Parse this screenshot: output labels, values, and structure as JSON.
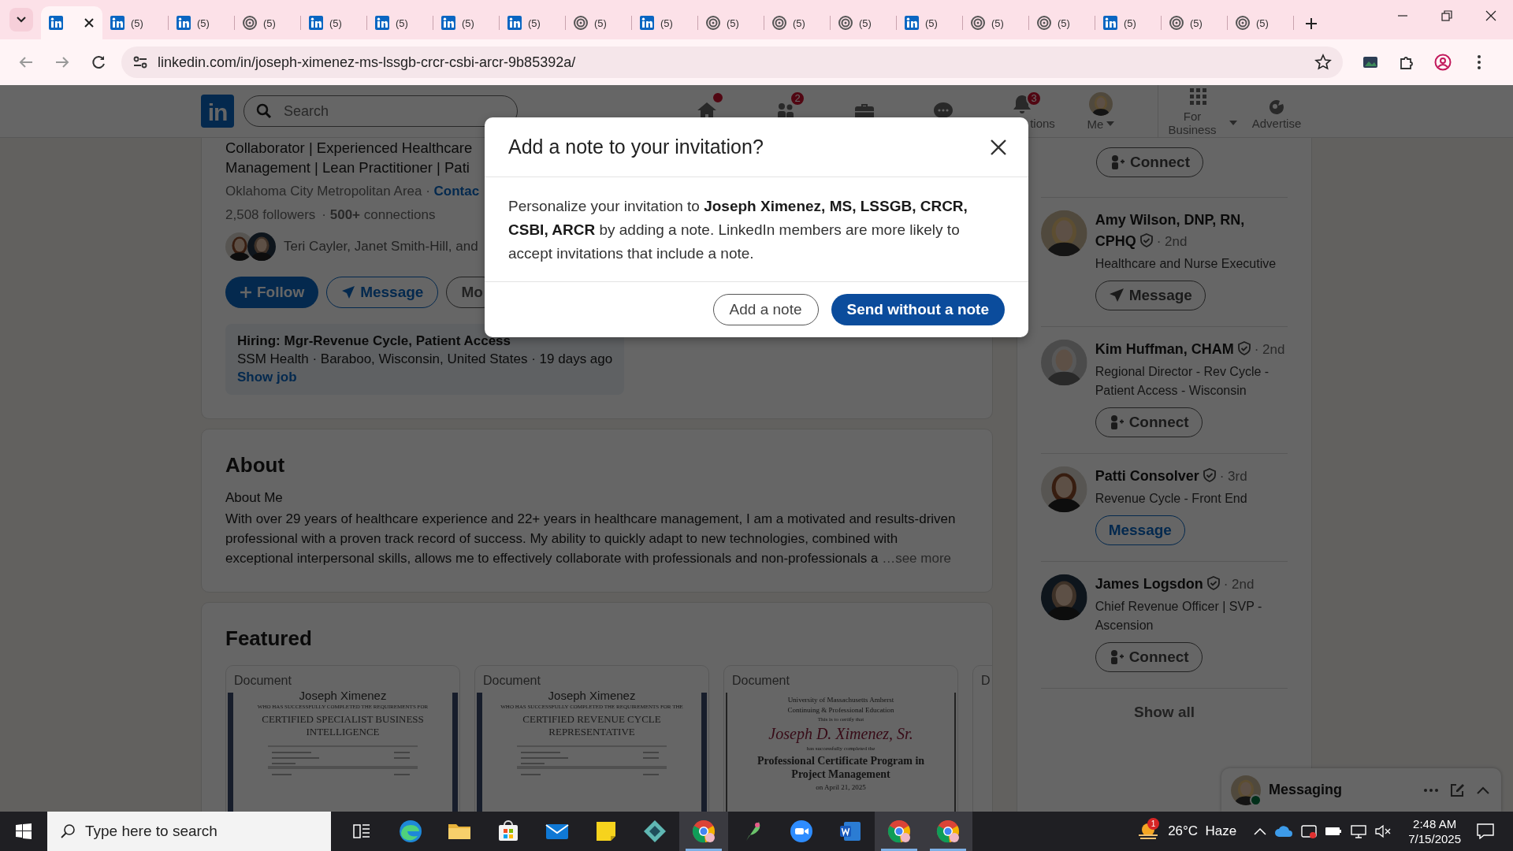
{
  "browser": {
    "tabs": [
      {
        "kind": "linkedin",
        "selected": true
      },
      {
        "kind": "linkedin",
        "title": "(5)",
        "selected": false
      },
      {
        "kind": "linkedin",
        "title": "(5)",
        "selected": false
      },
      {
        "kind": "spiral",
        "title": "(5)",
        "selected": false
      },
      {
        "kind": "linkedin",
        "title": "(5)",
        "selected": false
      },
      {
        "kind": "linkedin",
        "title": "(5)",
        "selected": false
      },
      {
        "kind": "linkedin",
        "title": "(5)",
        "selected": false
      },
      {
        "kind": "linkedin",
        "title": "(5)",
        "selected": false
      },
      {
        "kind": "spiral",
        "title": "(5)",
        "selected": false
      },
      {
        "kind": "linkedin",
        "title": "(5)",
        "selected": false
      },
      {
        "kind": "spiral",
        "title": "(5)",
        "selected": false
      },
      {
        "kind": "spiral",
        "title": "(5)",
        "selected": false
      },
      {
        "kind": "spiral",
        "title": "(5)",
        "selected": false
      },
      {
        "kind": "linkedin",
        "title": "(5)",
        "selected": false
      },
      {
        "kind": "spiral",
        "title": "(5)",
        "selected": false
      },
      {
        "kind": "spiral",
        "title": "(5)",
        "selected": false
      },
      {
        "kind": "linkedin",
        "title": "(5)",
        "selected": false
      },
      {
        "kind": "spiral",
        "title": "(5)",
        "selected": false
      },
      {
        "kind": "spiral",
        "title": "(5)",
        "selected": false
      }
    ],
    "address": "linkedin.com/in/joseph-ximenez-ms-lssgb-crcr-csbi-arcr-9b85392a/"
  },
  "header": {
    "logo": "in",
    "search": {
      "placeholder": "Search"
    },
    "nav": [
      {
        "kind": "home",
        "dot": true
      },
      {
        "kind": "network",
        "badge": "2"
      },
      {
        "kind": "jobs"
      },
      {
        "kind": "messaging"
      },
      {
        "kind": "notifications",
        "badge": "3",
        "label": "tions"
      },
      {
        "kind": "me",
        "label": "Me",
        "dropdown": true
      },
      {
        "kind": "business",
        "label": "For Business",
        "dropdown": true
      },
      {
        "kind": "advertise",
        "label": "Advertise"
      }
    ]
  },
  "profile": {
    "headline": [
      "Collaborator | Experienced Healthcare",
      "Management | Lean Practitioner | Pati"
    ],
    "location": "Oklahoma City Metropolitan Area · ",
    "contact": "Contac",
    "followers": "2,508 followers",
    "connections": "· **500+** connections",
    "mutual": "Teri Cayler, Janet Smith-Hill, and",
    "buttons": [
      {
        "kind": "primary",
        "label": "Follow"
      },
      {
        "kind": "outline",
        "label": "Message"
      },
      {
        "kind": "plain",
        "label": "Mo"
      }
    ],
    "job": {
      "title": "Hiring: Mgr-Revenue Cycle, Patient Access",
      "detail": "SSM Health · Baraboo, Wisconsin, United States · 19 days ago",
      "link": "Show job"
    }
  },
  "about": {
    "title": "About",
    "subtitle": "About Me",
    "text": "With over 29 years of healthcare experience and 22+ years in healthcare management, I am a motivated and results-driven professional with a proven track record of success. My ability to quickly adapt to new technologies, combined with exceptional interpersonal skills, allows me to effectively collaborate with professionals and non-professionals a",
    "more": "…see more"
  },
  "featured": {
    "title": "Featured",
    "items": [
      {
        "label": "Document",
        "kind": "certificate",
        "lines": [
          {
            "kind": "name",
            "text": "Joseph Ximenez"
          },
          {
            "kind": "small",
            "text": "WHO HAS SUCCESSFULLY COMPLETED THE REQUIREMENTS FOR"
          },
          {
            "kind": "title",
            "text": "CERTIFIED SPECIALIST BUSINESS INTELLIGENCE"
          }
        ]
      },
      {
        "label": "Document",
        "kind": "certificate",
        "lines": [
          {
            "kind": "name",
            "text": "Joseph Ximenez"
          },
          {
            "kind": "small",
            "text": "WHO HAS SUCCESSFULLY COMPLETED THE REQUIREMENTS FOR THE"
          },
          {
            "kind": "title",
            "text": "CERTIFIED REVENUE CYCLE REPRESENTATIVE"
          }
        ]
      },
      {
        "label": "Document",
        "kind": "diploma",
        "lines": [
          {
            "kind": "tiny",
            "text": "University of Massachusetts Amherst"
          },
          {
            "kind": "tiny",
            "text": "Continuing & Professional Education"
          },
          {
            "kind": "small",
            "text": "This is to certify that"
          },
          {
            "kind": "script",
            "text": "Joseph D. Ximenez, Sr."
          },
          {
            "kind": "small",
            "text": "has successfully completed the"
          },
          {
            "kind": "heading",
            "text": "Professional Certificate Program in Project Management"
          },
          {
            "kind": "tiny",
            "text": "on April 21, 2025"
          }
        ]
      },
      {
        "label": "D",
        "kind": "edge"
      }
    ]
  },
  "sidebar": {
    "top_action": {
      "kind": "connect",
      "label": "Connect"
    },
    "people": [
      {
        "name": "Amy Wilson, DNP, RN, CPHQ",
        "verified": true,
        "degree": "· 2nd",
        "headline": "Healthcare and Nurse Executive",
        "action": {
          "kind": "message",
          "label": "Message"
        }
      },
      {
        "name": "Kim Huffman, CHAM",
        "verified": true,
        "degree": "· 2nd",
        "headline": "Regional Director - Rev Cycle - Patient Access - Wisconsin",
        "action": {
          "kind": "connect",
          "label": "Connect"
        }
      },
      {
        "name": "Patti Consolver",
        "verified": true,
        "degree": "· 3rd",
        "headline": "Revenue Cycle - Front End",
        "action": {
          "kind": "link",
          "label": "Message"
        }
      },
      {
        "name": "James Logsdon",
        "verified": true,
        "degree": "· 2nd",
        "headline": "Chief Revenue Officer | SVP - Ascension",
        "action": {
          "kind": "connect",
          "label": "Connect"
        }
      }
    ],
    "show_all": "Show all"
  },
  "messaging": {
    "label": "Messaging",
    "online": true
  },
  "dialog": {
    "title": "Add a note to your invitation?",
    "body": "Personalize your invitation to **Joseph Ximenez, MS, LSSGB, CRCR, CSBI, ARCR** by adding a note. LinkedIn members are more likely to accept invitations that include a note.",
    "buttons": [
      {
        "kind": "secondary",
        "label": "Add a note"
      },
      {
        "kind": "primary",
        "label": "Send without a note"
      }
    ]
  },
  "taskbar": {
    "search": {
      "placeholder": "Type here to search"
    },
    "apps": [
      {
        "kind": "edge",
        "active": false
      },
      {
        "kind": "folder",
        "active": false
      },
      {
        "kind": "store",
        "active": false
      },
      {
        "kind": "mail",
        "active": false
      },
      {
        "kind": "notes",
        "active": false
      },
      {
        "kind": "diamond",
        "active": false
      },
      {
        "kind": "browser",
        "active": true
      },
      {
        "kind": "feather",
        "active": false
      },
      {
        "kind": "video",
        "active": false
      },
      {
        "kind": "word",
        "active": false
      },
      {
        "kind": "browser",
        "active": true
      },
      {
        "kind": "browser",
        "active": true
      }
    ],
    "weather": {
      "badge": "1",
      "text": "26°C  Haze"
    },
    "time": "2:48 AM",
    "date": "7/15/2025"
  }
}
